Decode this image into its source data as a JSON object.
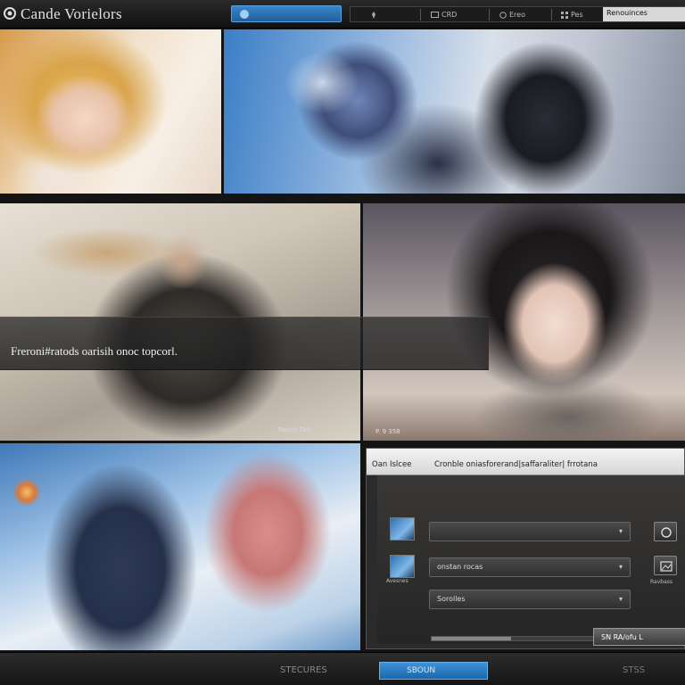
{
  "app": {
    "title": "Cande Vorielors",
    "search_label": ""
  },
  "nav": {
    "items": [
      {
        "icon": "pin-icon",
        "label": ""
      },
      {
        "icon": "tv-icon",
        "label": "CRD"
      },
      {
        "icon": "globe-icon",
        "label": "Ereo"
      },
      {
        "icon": "grid-icon",
        "label": "Pes"
      }
    ],
    "active_label": "Renouinces"
  },
  "gallery": {
    "panel2_label": "",
    "caption": "Freroni#ratods oarisih onoc topcorl.",
    "panel3_label": "Parico  Odc",
    "panel4_label": "P. 9 358"
  },
  "dialog": {
    "tab_left": "Oan Islcee",
    "tab_right": "Cronble oniasforerand|saffaraliter| frrotana",
    "field1_value": "",
    "field2_value": "onstan rocas",
    "field3_value": "Sorolles",
    "thumb_caption_1": "",
    "thumb_caption_2": "Avesnes",
    "side_caption_1": "",
    "side_caption_2": "Ravbass",
    "progress": 0.45,
    "ok_label": "SN RA/ofu  L"
  },
  "footer": {
    "left_label": "STECURES",
    "button_label": "SBOUN",
    "right_label": "STSS"
  },
  "colors": {
    "accent": "#2f7fc4",
    "panel_bg": "#2b2b2b",
    "bar_bg": "#141414"
  }
}
